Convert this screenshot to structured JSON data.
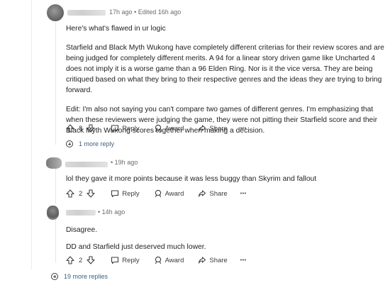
{
  "comment1": {
    "time": "17h ago",
    "sep": "•",
    "edited": "Edited 16h ago",
    "paragraphs": [
      "Here's what's flawed in ur logic",
      "Starfield and Black Myth Wukong have completely different criterias for their review scores and are being judged for completely different merits. A 94 for a linear story driven game like Uncharted 4 does not imply it is a worse game than a 96 Elden Ring. Nor is it the vice versa. They are being critiqued based on what they bring to their respective genres and the ideas they are trying to bring forward.",
      "Edit: I'm also not saying you can't compare two games of different genres. I'm emphasizing that when these reviewers were judging the game, they were not pitting their Starfield score and their Black Myth Wukong scores together when making a decision."
    ],
    "votes": "8",
    "reply_label": "Reply",
    "award_label": "Award",
    "share_label": "Share",
    "more_label": "•••",
    "more_replies": "1 more reply"
  },
  "comment2": {
    "sep": "•",
    "time": "19h ago",
    "paragraphs": [
      "lol they gave it more points because it was less buggy than Skyrim and fallout"
    ],
    "votes": "2",
    "reply_label": "Reply",
    "award_label": "Award",
    "share_label": "Share",
    "more_label": "•••"
  },
  "comment3": {
    "sep": "•",
    "time": "14h ago",
    "paragraphs": [
      "Disagree.",
      "DD and Starfield just deserved much lower."
    ],
    "votes": "2",
    "reply_label": "Reply",
    "award_label": "Award",
    "share_label": "Share",
    "more_label": "•••"
  },
  "footer": {
    "more_replies": "19 more replies"
  },
  "colors": {
    "thread_line": "#e5e5e5",
    "link": "#3f5f7f",
    "text": "#1c1c1c"
  },
  "icons": [
    "upvote-icon",
    "downvote-icon",
    "reply-icon",
    "award-icon",
    "share-icon",
    "more-icon",
    "expand-icon"
  ]
}
